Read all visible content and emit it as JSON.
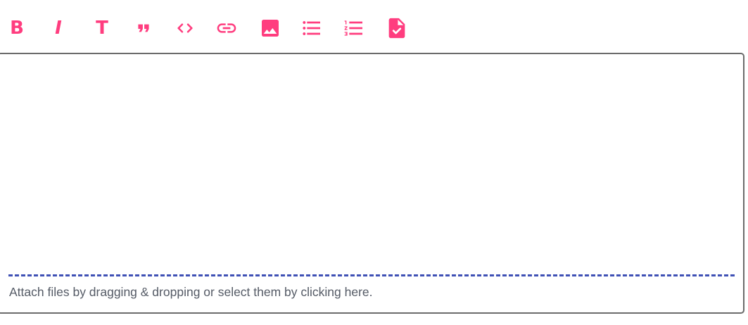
{
  "colors": {
    "icon_accent": "#ff3d7f",
    "divider": "#3f51b5",
    "border": "#6b6b6b",
    "hint_text": "#555b66"
  },
  "toolbar": {
    "buttons": [
      {
        "name": "bold-button",
        "icon": "bold-icon",
        "glyph": "B"
      },
      {
        "name": "italic-button",
        "icon": "italic-icon",
        "glyph": "I"
      },
      {
        "name": "header-button",
        "icon": "text-heading-icon",
        "glyph": "T"
      },
      {
        "name": "quote-button",
        "icon": "quote-icon"
      },
      {
        "name": "code-button",
        "icon": "code-icon"
      },
      {
        "name": "link-button",
        "icon": "link-icon"
      },
      {
        "name": "image-button",
        "icon": "image-icon"
      },
      {
        "name": "unordered-list-button",
        "icon": "bulleted-list-icon"
      },
      {
        "name": "ordered-list-button",
        "icon": "numbered-list-icon"
      },
      {
        "name": "task-list-button",
        "icon": "file-check-icon"
      }
    ]
  },
  "editor": {
    "value": "",
    "attach_hint": "Attach files by dragging & dropping or select them by clicking here."
  }
}
